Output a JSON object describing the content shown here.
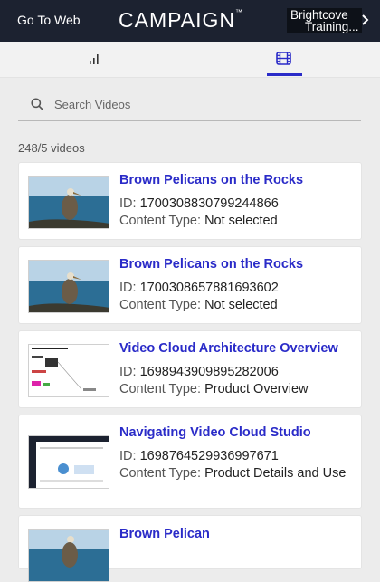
{
  "header": {
    "go_to_web": "Go To Web",
    "logo": "CAMPAIGN",
    "logo_mark": "™",
    "training_line1": "Brightcove",
    "training_line2": "Training..."
  },
  "search": {
    "placeholder": "Search Videos",
    "value": ""
  },
  "results": {
    "count_text": "248/5 videos"
  },
  "labels": {
    "id": "ID:",
    "content_type": "Content Type:"
  },
  "videos": [
    {
      "title": "Brown Pelicans on the Rocks",
      "id": "1700308830799244866",
      "content_type": "Not selected"
    },
    {
      "title": "Brown Pelicans on the Rocks",
      "id": "1700308657881693602",
      "content_type": "Not selected"
    },
    {
      "title": "Video Cloud Architecture Overview",
      "id": "1698943909895282006",
      "content_type": "Product Overview"
    },
    {
      "title": "Navigating Video Cloud Studio",
      "id": "1698764529936997671",
      "content_type": "Product Details and Use"
    },
    {
      "title": "Brown Pelican",
      "id": "",
      "content_type": ""
    }
  ],
  "colors": {
    "header_bg": "#1c2230",
    "link": "#2a2bc8",
    "active_tab": "#2a2bc8"
  }
}
